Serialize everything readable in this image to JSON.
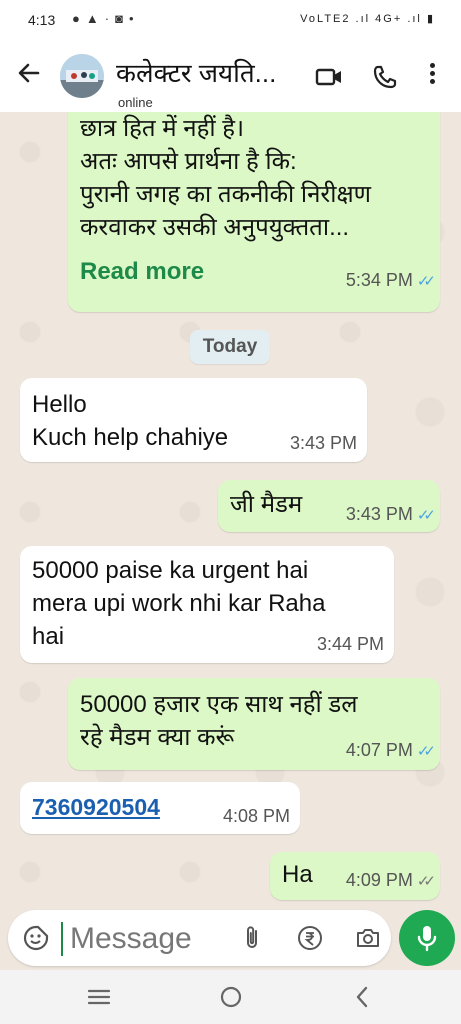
{
  "status_bar": {
    "time": "4:13",
    "left_icons": [
      "notification-icon",
      "alert-icon",
      "dot-icon",
      "app-icon",
      "dot-icon"
    ],
    "right_text": "VoLTE2 .ıl 4G+ .ıl"
  },
  "header": {
    "contact_name": "कलेक्टर जयति...",
    "status": "online"
  },
  "messages": [
    {
      "direction": "out",
      "lines": [
        "छात्र हित में नहीं है।",
        "अतः आपसे प्रार्थना है कि:",
        "पुरानी जगह का तकनीकी निरीक्षण",
        "करवाकर उसकी अनुपयुक्तता..."
      ],
      "read_more": "Read more",
      "time": "5:34 PM",
      "ticks": "read"
    },
    {
      "direction": "date",
      "text": "Today"
    },
    {
      "direction": "in",
      "lines": [
        "Hello",
        "Kuch help chahiye"
      ],
      "time": "3:43 PM"
    },
    {
      "direction": "out",
      "lines": [
        "जी मैडम"
      ],
      "time": "3:43 PM",
      "ticks": "read"
    },
    {
      "direction": "in",
      "lines": [
        "50000 paise ka urgent hai",
        "mera upi work nhi kar Raha",
        "hai"
      ],
      "time": "3:44 PM"
    },
    {
      "direction": "out",
      "lines": [
        "50000 हजार एक साथ नहीं डल",
        "रहे मैडम क्या करूं"
      ],
      "time": "4:07 PM",
      "ticks": "read"
    },
    {
      "direction": "in",
      "link": "7360920504",
      "time": "4:08 PM"
    },
    {
      "direction": "out",
      "lines": [
        "Ha"
      ],
      "time": "4:09 PM",
      "ticks": "delivered"
    }
  ],
  "input": {
    "placeholder": "Message"
  },
  "colors": {
    "chat_bg": "#efe7de",
    "outgoing_bubble": "#dcf8c6",
    "incoming_bubble": "#ffffff",
    "accent_green": "#1ea952",
    "read_tick": "#4fa3e0",
    "link": "#1a5fb0"
  }
}
